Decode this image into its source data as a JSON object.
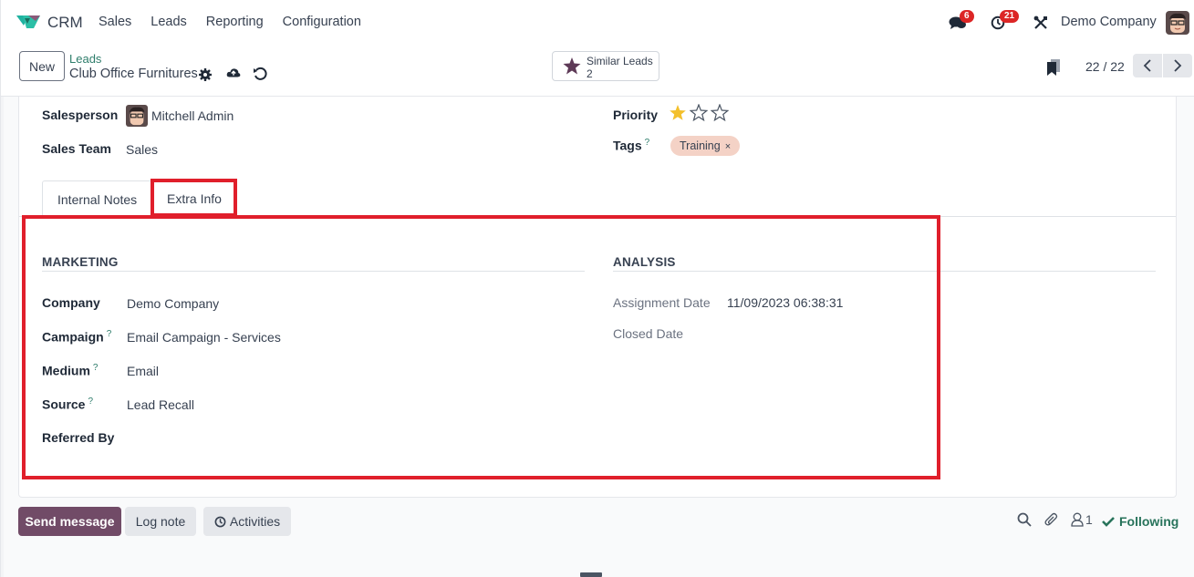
{
  "navbar": {
    "app_name": "CRM",
    "menu": [
      "Sales",
      "Leads",
      "Reporting",
      "Configuration"
    ],
    "messages_badge": "6",
    "activities_badge": "21",
    "company": "Demo Company",
    "icons": [
      "chat-icon",
      "clock-icon",
      "tools-icon",
      "user-avatar"
    ]
  },
  "control_panel": {
    "new_label": "New",
    "breadcrumb_parent": "Leads",
    "record_name": "Club Office Furnitures",
    "similar_leads_label": "Similar Leads",
    "similar_leads_count": "2",
    "pager": "22 / 22"
  },
  "form": {
    "salesperson_label": "Salesperson",
    "salesperson_value": "Mitchell Admin",
    "sales_team_label": "Sales Team",
    "sales_team_value": "Sales",
    "priority_label": "Priority",
    "priority_value": 1,
    "priority_max": 3,
    "tags_label": "Tags",
    "tags_help": "?",
    "tags": [
      "Training"
    ],
    "tags_remove": "×"
  },
  "tabs": [
    {
      "label": "Internal Notes",
      "active": false
    },
    {
      "label": "Extra Info",
      "active": true
    }
  ],
  "extra_info": {
    "marketing": {
      "title": "MARKETING",
      "fields": [
        {
          "label": "Company",
          "help": "",
          "value": "Demo Company"
        },
        {
          "label": "Campaign",
          "help": "?",
          "value": "Email Campaign - Services"
        },
        {
          "label": "Medium",
          "help": "?",
          "value": "Email"
        },
        {
          "label": "Source",
          "help": "?",
          "value": "Lead Recall"
        },
        {
          "label": "Referred By",
          "help": "",
          "value": ""
        }
      ]
    },
    "analysis": {
      "title": "ANALYSIS",
      "fields": [
        {
          "label": "Assignment Date",
          "value": "11/09/2023 06:38:31"
        },
        {
          "label": "Closed Date",
          "value": ""
        }
      ]
    }
  },
  "chatter": {
    "send_message": "Send message",
    "log_note": "Log note",
    "activities": "Activities",
    "followers_count": "1",
    "following": "Following"
  },
  "colors": {
    "brand": "#714b67",
    "highlight": "#e01f2b",
    "link": "#2e7d6b",
    "star": "#f3c02c",
    "tag_bg": "#f4d2c6"
  }
}
